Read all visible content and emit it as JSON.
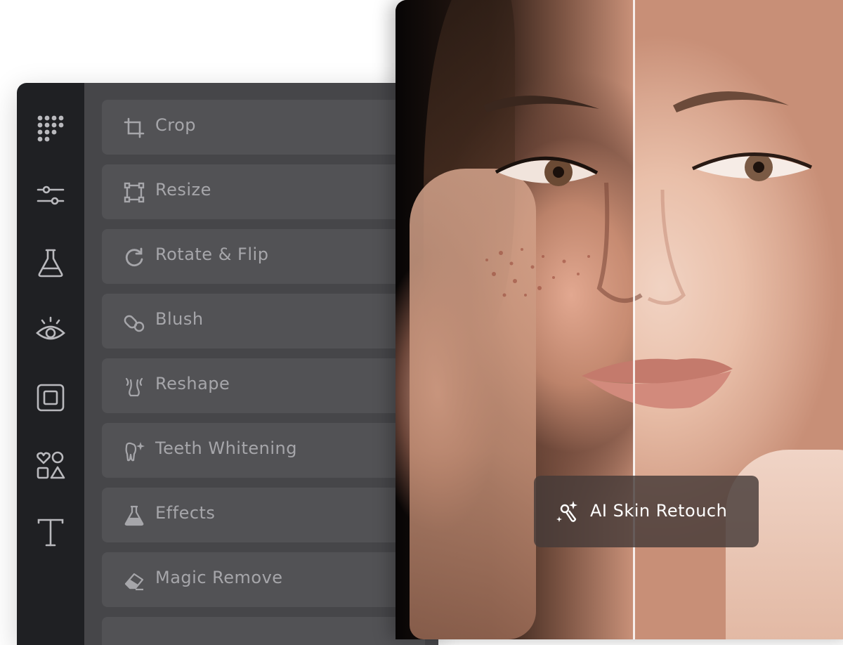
{
  "sidebar": {
    "items": [
      {
        "icon": "apps-grid-icon"
      },
      {
        "icon": "sliders-icon"
      },
      {
        "icon": "flask-icon"
      },
      {
        "icon": "eye-icon"
      },
      {
        "icon": "frame-icon"
      },
      {
        "icon": "shapes-icon"
      },
      {
        "icon": "text-icon"
      }
    ]
  },
  "tools": {
    "crop": {
      "label": "Crop",
      "icon": "crop-icon"
    },
    "resize": {
      "label": "Resize",
      "icon": "resize-icon"
    },
    "rotate": {
      "label": "Rotate & Flip",
      "icon": "rotate-icon"
    },
    "blush": {
      "label": "Blush",
      "icon": "blush-brush-icon"
    },
    "reshape": {
      "label": "Reshape",
      "icon": "reshape-icon"
    },
    "teeth": {
      "label": "Teeth Whitening",
      "icon": "tooth-sparkle-icon"
    },
    "effects": {
      "label": "Effects",
      "icon": "flask-filled-icon"
    },
    "magic_remove": {
      "label": "Magic Remove",
      "icon": "eraser-icon"
    }
  },
  "badge": {
    "label": "AI Skin Retouch",
    "icon": "magic-retouch-icon"
  },
  "colors": {
    "rail_bg": "#1f2023",
    "menu_bg": "#464649",
    "item_bg": "#525255",
    "text_muted": "#a6a6aa",
    "badge_bg": "#463a38"
  }
}
